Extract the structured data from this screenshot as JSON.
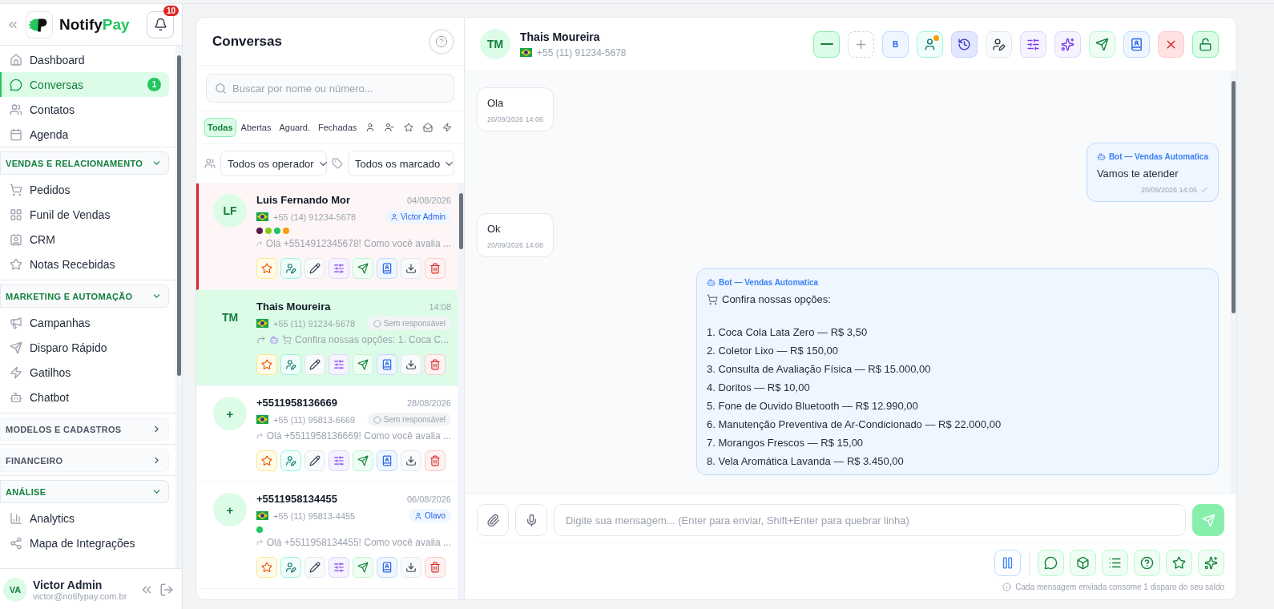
{
  "sidebar": {
    "brand": {
      "name": "Notify",
      "accent": "Pay"
    },
    "notifications": "10",
    "nav": [
      {
        "kind": "link",
        "label": "Dashboard",
        "selected": false
      },
      {
        "kind": "link",
        "label": "Conversas",
        "selected": true,
        "badge": "1"
      },
      {
        "kind": "link",
        "label": "Contatos",
        "selected": false
      },
      {
        "kind": "link",
        "label": "Agenda",
        "selected": false
      },
      {
        "kind": "section",
        "label": "VENDAS E RELACIONAMENTO",
        "expanded": true,
        "children": [
          {
            "label": "Pedidos",
            "selected": false
          },
          {
            "label": "Funil de Vendas",
            "selected": false
          },
          {
            "label": "CRM",
            "selected": false
          },
          {
            "label": "Notas Recebidas",
            "selected": false
          }
        ]
      },
      {
        "kind": "section",
        "label": "MARKETING E AUTOMAÇÃO",
        "expanded": true,
        "children": [
          {
            "label": "Campanhas",
            "selected": false
          },
          {
            "label": "Disparo Rápido",
            "selected": false
          },
          {
            "label": "Gatilhos",
            "selected": false
          },
          {
            "label": "Chatbot",
            "selected": false
          }
        ]
      },
      {
        "kind": "section",
        "label": "MODELOS E CADASTROS",
        "expanded": false
      },
      {
        "kind": "section",
        "label": "FINANCEIRO",
        "expanded": false
      },
      {
        "kind": "section",
        "label": "ANÁLISE",
        "expanded": true,
        "children": [
          {
            "label": "Analytics",
            "selected": false
          },
          {
            "label": "Mapa de Integrações",
            "selected": false
          }
        ]
      }
    ],
    "user": {
      "initials": "VA",
      "name": "Victor Admin",
      "email": "victor@notifypay.com.br"
    }
  },
  "conversation_list": {
    "title": "Conversas",
    "search": {
      "placeholder": "Buscar por nome ou número..."
    },
    "filters": [
      {
        "label": "Todas",
        "selected": true
      },
      {
        "label": "Abertas",
        "selected": false
      },
      {
        "label": "Aguard.",
        "selected": false
      },
      {
        "label": "Fechadas",
        "selected": false
      }
    ],
    "operator_select": "Todos os operador",
    "tag_select": "Todos os marcado",
    "conversations": [
      {
        "initials": "LF",
        "name": "Luis Fernando Mor",
        "time": "04/08/2026",
        "phone": "+55 (14) 91234-5678",
        "assignee": {
          "kind": "user",
          "label": "Victor Admin"
        },
        "tags": [
          {
            "color": "#5b1a4a"
          },
          {
            "color": "#84cc16"
          },
          {
            "color": "#22c55e"
          },
          {
            "color": "#f59e0b"
          }
        ],
        "preview": "Olá +5514912345678! Como você avalia ...",
        "urgent": true,
        "selected": false
      },
      {
        "initials": "TM",
        "name": "Thais Moureira",
        "time": "14:08",
        "phone": "+55 (11) 91234-5678",
        "assignee": {
          "kind": "none",
          "label": "Sem responsável"
        },
        "bot_preview": true,
        "preview": "Confira nossas opções: 1. Coca C...",
        "urgent": false,
        "selected": true
      },
      {
        "initials": "+",
        "name": "+5511958136669",
        "time": "28/08/2026",
        "phone": "+55 (11) 95813-6669",
        "assignee": {
          "kind": "none",
          "label": "Sem responsável"
        },
        "preview": "Olá +5511958136669! Como você avalia ...",
        "urgent": false,
        "selected": false
      },
      {
        "initials": "+",
        "name": "+5511958134455",
        "time": "06/08/2026",
        "phone": "+55 (11) 95813-4455",
        "assignee": {
          "kind": "user",
          "label": "Olavo"
        },
        "tags": [
          {
            "color": "#22c55e"
          }
        ],
        "preview": "Olá +5511958134455! Como você avalia ...",
        "urgent": false,
        "selected": false
      }
    ]
  },
  "chat": {
    "header": {
      "initials": "TM",
      "name": "Thais Moureira",
      "phone": "+55 (11) 91234-5678",
      "bot_button": "B"
    },
    "messages": [
      {
        "kind": "incoming",
        "text": "Ola",
        "time": "20/09/2026 14:06"
      },
      {
        "kind": "bot",
        "sender": "Bot — Vendas Automatica",
        "text": "Vamos te atender",
        "time": "20/09/2026 14:06",
        "read": true
      },
      {
        "kind": "incoming",
        "text": "Ok",
        "time": "20/09/2026 14:08"
      },
      {
        "kind": "bot",
        "sender": "Bot — Vendas Automatica",
        "intro": "Confira nossas opções:",
        "items": [
          "1. Coca Cola Lata Zero — R$ 3,50",
          "2. Coletor Lixo — R$ 150,00",
          "3. Consulta de Avaliação Física — R$ 15.000,00",
          "4. Doritos — R$ 10,00",
          "5. Fone de Ouvido Bluetooth — R$ 12.990,00",
          "6. Manutenção Preventiva de Ar-Condicionado — R$ 22.000,00",
          "7. Morangos Frescos — R$ 15,00",
          "8. Vela Aromática Lavanda — R$ 3.450,00"
        ]
      }
    ],
    "composer": {
      "placeholder": "Digite sua mensagem... (Enter para enviar, Shift+Enter para quebrar linha)",
      "note": "Cada mensagem enviada consome 1 disparo do seu saldo"
    }
  }
}
